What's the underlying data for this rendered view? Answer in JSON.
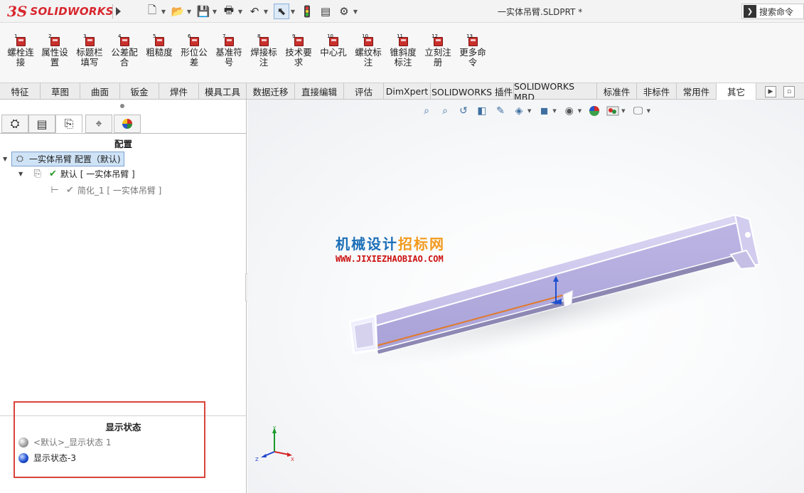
{
  "titlebar": {
    "brand": "SOLIDWORKS",
    "brand_mark": "3S",
    "document_title": "一实体吊臂.SLDPRT *",
    "search_label": "搜索命令",
    "quick_access": [
      "new-icon",
      "open-icon",
      "save-icon",
      "print-icon",
      "undo-icon",
      "select-icon",
      "traffic-light-icon",
      "file-properties-icon",
      "options-icon"
    ]
  },
  "ribbon": {
    "buttons": [
      {
        "num": "1",
        "label": "螺栓连接"
      },
      {
        "num": "2",
        "label": "属性设置"
      },
      {
        "num": "3",
        "label": "标题栏填写"
      },
      {
        "num": "4",
        "label": "公差配合"
      },
      {
        "num": "5",
        "label": "粗糙度"
      },
      {
        "num": "6",
        "label": "形位公差"
      },
      {
        "num": "7",
        "label": "基准符号"
      },
      {
        "num": "8",
        "label": "焊接标注"
      },
      {
        "num": "9",
        "label": "技术要求"
      },
      {
        "num": "10",
        "label": "中心孔"
      },
      {
        "num": "10",
        "label": "螺纹标注"
      },
      {
        "num": "11",
        "label": "锥斜度标注"
      },
      {
        "num": "12",
        "label": "立刻注册"
      },
      {
        "num": "13",
        "label": "更多命令"
      }
    ]
  },
  "tabs": [
    "特征",
    "草图",
    "曲面",
    "钣金",
    "焊件",
    "模具工具",
    "数据迁移",
    "直接编辑",
    "评估",
    "DimXpert",
    "SOLIDWORKS 插件",
    "SOLIDWORKS MBD",
    "标准件",
    "非标件",
    "常用件",
    "其它"
  ],
  "active_tab": "其它",
  "panel": {
    "heading": "配置",
    "tabs": [
      "feature-manager-icon",
      "property-manager-icon",
      "configuration-manager-icon",
      "dimxpert-manager-icon",
      "display-manager-icon"
    ],
    "tree": {
      "root": "一实体吊臂 配置（默认)",
      "child": "默认 [ 一实体吊臂 ]",
      "grandchild": "简化_1 [ 一实体吊臂 ]"
    }
  },
  "display_states": {
    "heading": "显示状态",
    "items": [
      {
        "label": "<默认>_显示状态 1",
        "state": "inactive"
      },
      {
        "label": "显示状态-3",
        "state": "active"
      }
    ]
  },
  "viewport": {
    "watermark_line1_a": "机械设计",
    "watermark_line1_b": "招标网",
    "watermark_line2": "WWW.JIXIEZHAOBIAO.COM",
    "triad": {
      "x": "X",
      "y": "Y",
      "z": "Z"
    },
    "colors": {
      "model_face": "#c9c3ea",
      "model_edge": "#ffffff",
      "accent": "#e07a2a"
    }
  }
}
